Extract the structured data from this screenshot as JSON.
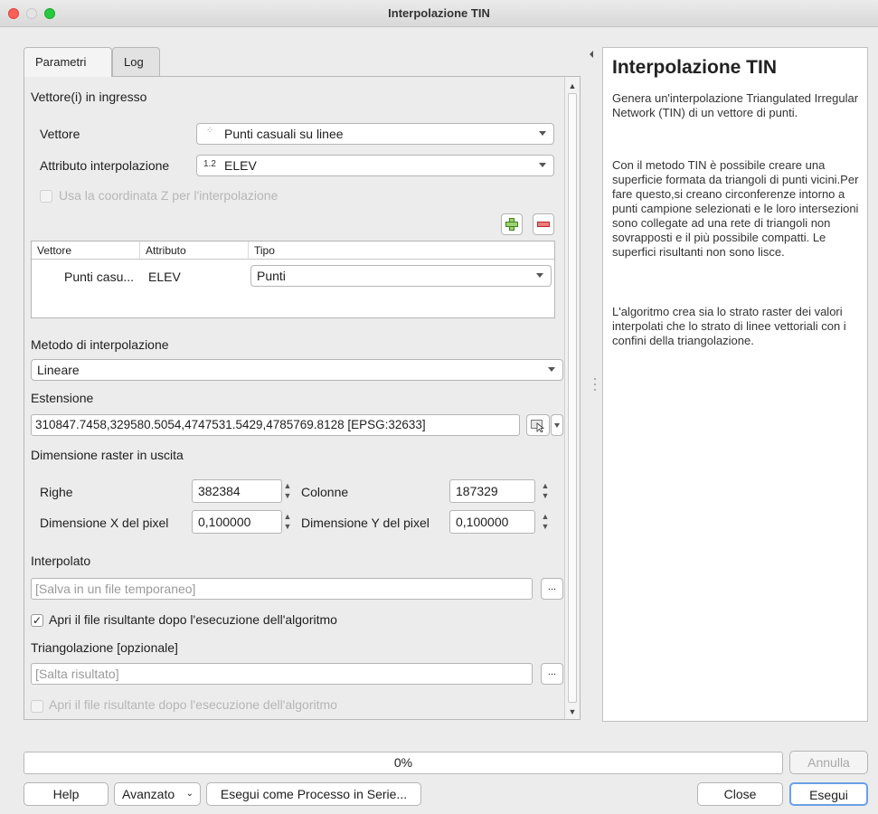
{
  "window": {
    "title": "Interpolazione TIN"
  },
  "tabs": [
    {
      "label": "Parametri",
      "active": true
    },
    {
      "label": "Log",
      "active": false
    }
  ],
  "form": {
    "input_section": "Vettore(i) in ingresso",
    "vector_label": "Vettore",
    "vector_value": "Punti casuali su linee",
    "attr_label": "Attributo interpolazione",
    "attr_type": "1.2",
    "attr_value": "ELEV",
    "use_z_label": "Usa la coordinata Z per l'interpolazione",
    "table": {
      "columns": [
        "Vettore",
        "Attributo",
        "Tipo"
      ],
      "rows": [
        {
          "vettore": "Punti casu...",
          "attributo": "ELEV",
          "tipo": "Punti"
        }
      ]
    },
    "method_label": "Metodo di interpolazione",
    "method_value": "Lineare",
    "extent_label": "Estensione",
    "extent_value": "310847.7458,329580.5054,4747531.5429,4785769.8128 [EPSG:32633]",
    "raster_size_label": "Dimensione raster in uscita",
    "rows_label": "Righe",
    "rows_value": "382384",
    "cols_label": "Colonne",
    "cols_value": "187329",
    "pixel_x_label": "Dimensione X del pixel",
    "pixel_x_value": "0,100000",
    "pixel_y_label": "Dimensione Y del pixel",
    "pixel_y_value": "0,100000",
    "interpolated_label": "Interpolato",
    "interpolated_placeholder": "[Salva in un file temporaneo]",
    "open_after_label": "Apri il file risultante dopo l'esecuzione dell'algoritmo",
    "open_after_checked": true,
    "triangulation_label": "Triangolazione [opzionale]",
    "triangulation_placeholder": "[Salta risultato]",
    "open_after2_label": "Apri il file risultante dopo l'esecuzione dell'algoritmo",
    "open_after2_checked": false,
    "browse_label": "..."
  },
  "help": {
    "title": "Interpolazione TIN",
    "p1": "Genera un'interpolazione Triangulated Irregular Network (TIN) di un vettore di punti.",
    "p2": "Con il metodo TIN è possibile creare una superficie formata da triangoli di punti vicini.Per fare questo,si creano circonferenze intorno a punti campione selezionati e le loro intersezioni sono collegate ad una rete di triangoli non sovrapposti e il più possibile compatti. Le superfici risultanti non sono lisce.",
    "p3": "L'algoritmo crea sia lo strato raster dei valori interpolati che lo strato di linee vettoriali con i confini della triangolazione."
  },
  "progress": {
    "text": "0%",
    "value": 0
  },
  "buttons": {
    "cancel": "Annulla",
    "help": "Help",
    "advanced": "Avanzato",
    "batch": "Esegui come Processo in Serie...",
    "close": "Close",
    "run": "Esegui"
  },
  "icons": {
    "add": "add-layer-icon",
    "remove": "remove-layer-icon",
    "point_layer": "point-layer-icon",
    "extent_select": "select-on-canvas-icon"
  }
}
